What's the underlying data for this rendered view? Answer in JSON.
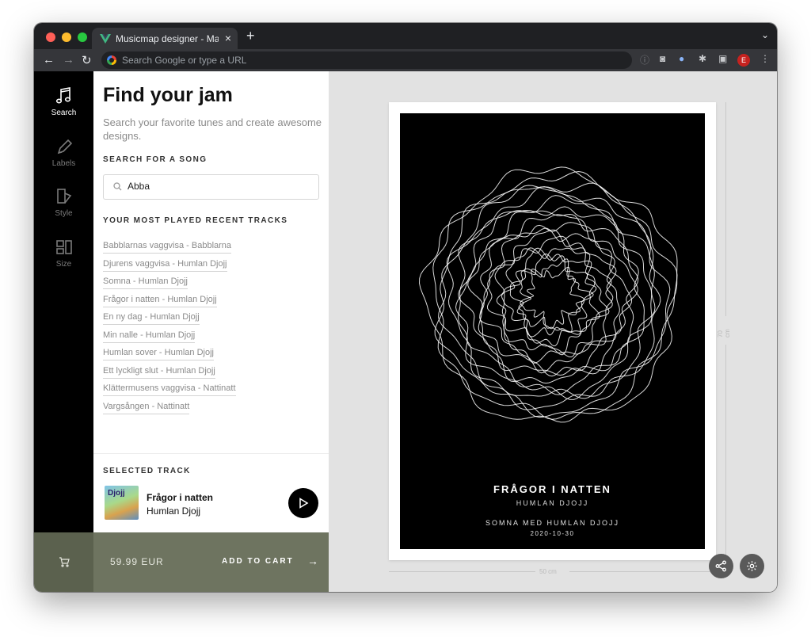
{
  "browser": {
    "tab_title": "Musicmap designer - Mapiful.c",
    "tab_close": "×",
    "new_tab": "+",
    "tab_menu": "⌄",
    "omnibox_placeholder": "Search Google or type a URL",
    "profile_initial": "E"
  },
  "sidebar": {
    "items": [
      {
        "label": "Search",
        "icon": "music-note-icon",
        "active": true
      },
      {
        "label": "Labels",
        "icon": "pencil-icon",
        "active": false
      },
      {
        "label": "Style",
        "icon": "style-shapes-icon",
        "active": false
      },
      {
        "label": "Size",
        "icon": "size-frames-icon",
        "active": false
      }
    ]
  },
  "panel": {
    "title": "Find your jam",
    "subtitle": "Search your favorite tunes and create awesome designs.",
    "search_label": "SEARCH FOR A SONG",
    "search_value": "Abba",
    "recent_label": "YOUR MOST PLAYED RECENT TRACKS",
    "recent_tracks": [
      "Babblarnas vaggvisa - Babblarna",
      "Djurens vaggvisa - Humlan Djojj",
      "Somna - Humlan Djojj",
      "Frågor i natten - Humlan Djojj",
      "En ny dag - Humlan Djojj",
      "Min nalle - Humlan Djojj",
      "Humlan sover - Humlan Djojj",
      "Ett lyckligt slut - Humlan Djojj",
      "Klättermusens vaggvisa - Nattinatt",
      "Vargsången - Nattinatt"
    ],
    "selected_label": "SELECTED TRACK",
    "selected_title": "Frågor i natten",
    "selected_artist": "Humlan Djojj",
    "album_text": "Djojj"
  },
  "cart": {
    "price": "59.99 EUR",
    "add_label": "ADD TO CART",
    "arrow": "→"
  },
  "poster": {
    "title": "FRÅGOR I NATTEN",
    "artist": "HUMLAN DJOJJ",
    "dedication": "SOMNA MED HUMLAN DJOJJ",
    "date": "2020-10-30",
    "width_label": "50 cm",
    "height_label": "70 cm"
  },
  "colors": {
    "sidebar_bg": "#000000",
    "cart_bar": "#6e7460",
    "cart_icon_bg": "#5b614e",
    "canvas_bg": "#e2e2e2"
  }
}
